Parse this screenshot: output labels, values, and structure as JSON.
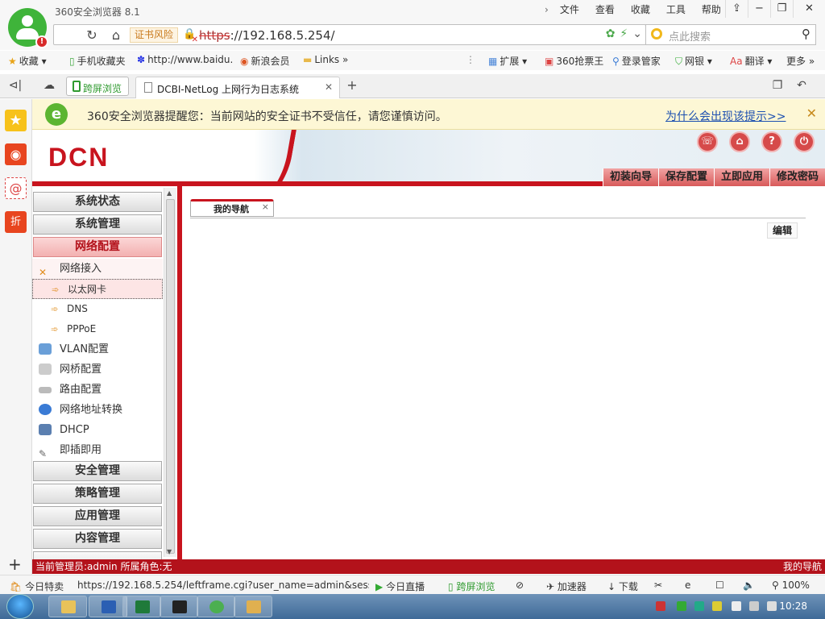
{
  "window": {
    "title": "360安全浏览器 8.1",
    "menu": [
      "文件",
      "查看",
      "收藏",
      "工具",
      "帮助"
    ]
  },
  "address_bar": {
    "cert_warning": "证书风险",
    "url_scheme": "https",
    "url_rest": "://192.168.5.254/",
    "search_placeholder": "点此搜索"
  },
  "bookmarks": {
    "left": [
      "收藏",
      "手机收藏夹",
      "http://www.baidu.",
      "新浪会员",
      "Links"
    ],
    "right": [
      "扩展",
      "360抢票王",
      "登录管家",
      "网银",
      "翻译",
      "更多"
    ]
  },
  "tabs": {
    "split_tab": "跨屏浏览",
    "active_tab": "DCBI-NetLog 上网行为日志系统"
  },
  "notice": {
    "message": "360安全浏览器提醒您：当前网站的安全证书不受信任，请您谨慎访问。",
    "link": "为什么会出现该提示>>"
  },
  "app": {
    "logo": "DCN",
    "top_nav": [
      "初装向导",
      "保存配置",
      "立即应用",
      "修改密码"
    ]
  },
  "left_menu": {
    "categories_top": [
      "系统状态",
      "系统管理",
      "网络配置"
    ],
    "network_items": [
      {
        "label": "网络接入",
        "icon": "network-access-icon"
      },
      {
        "label": "VLAN配置",
        "icon": "vlan-icon"
      },
      {
        "label": "网桥配置",
        "icon": "bridge-icon"
      },
      {
        "label": "路由配置",
        "icon": "router-icon"
      },
      {
        "label": "网络地址转换",
        "icon": "nat-icon"
      },
      {
        "label": "DHCP",
        "icon": "dhcp-icon"
      },
      {
        "label": "即插即用",
        "icon": "plug-icon"
      }
    ],
    "sub_items": [
      "以太网卡",
      "DNS",
      "PPPoE"
    ],
    "categories_bottom": [
      "安全管理",
      "策略管理",
      "应用管理",
      "内容管理"
    ]
  },
  "main": {
    "tab_label": "我的导航",
    "edit_button": "编辑"
  },
  "app_status": {
    "left": "当前管理员:admin  所属角色:无",
    "right": "我的导航"
  },
  "browser_status": {
    "deal": "今日特卖",
    "link_url": "https://192.168.5.254/leftframe.cgi?user_name=admin&sessio",
    "live": "今日直播",
    "split": "跨屏浏览",
    "accelerator": "加速器",
    "download": "下载",
    "zoom": "100%"
  },
  "taskbar": {
    "clock": "10:28"
  },
  "colors": {
    "brand_red": "#c8141e",
    "accent_green": "#3fb43a",
    "notice_bg": "#fdf7d5"
  }
}
